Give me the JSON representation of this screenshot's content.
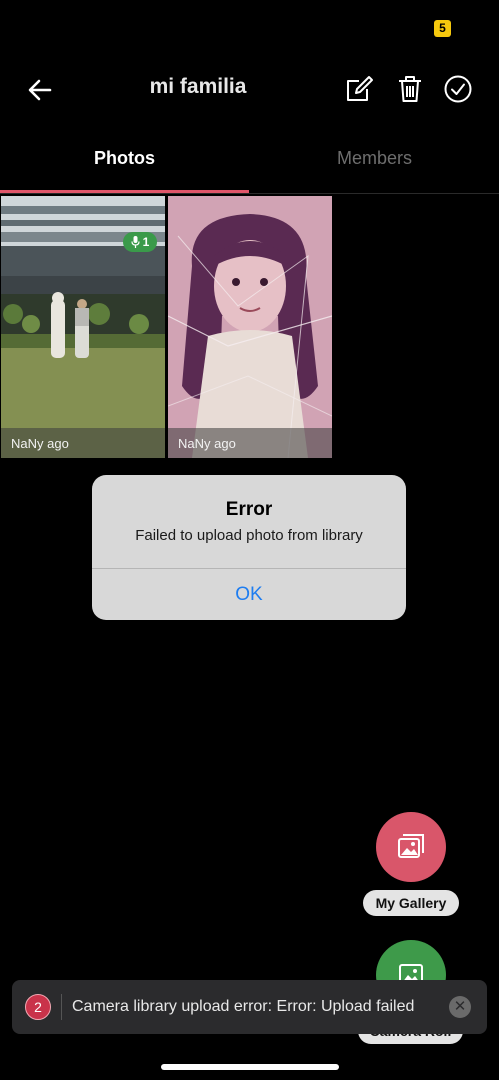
{
  "status_bar": {
    "badge_count": "5"
  },
  "header": {
    "title": "mi familia",
    "icons": [
      "back-arrow-icon",
      "edit-icon",
      "trash-icon",
      "checkmark-circle-icon"
    ]
  },
  "tabs": [
    {
      "label": "Photos",
      "selected": true
    },
    {
      "label": "Members",
      "selected": false
    }
  ],
  "photos": [
    {
      "time": "NaNy ago",
      "audio_count": "1",
      "audio_icon": "microphone-icon"
    },
    {
      "time": "NaNy ago"
    }
  ],
  "alert": {
    "title": "Error",
    "message": "Failed to upload photo from library",
    "ok_label": "OK"
  },
  "fab": {
    "gallery_label": "My Gallery",
    "gallery_icon": "gallery-icon",
    "camera_label": "Camera Roll",
    "camera_icon": "image-icon"
  },
  "toast": {
    "count": "2",
    "message": "Camera library upload error: Error: Upload failed",
    "close_icon": "close-icon"
  },
  "colors": {
    "accent": "#e0566a",
    "gallery_fab": "#d9566a",
    "camera_fab": "#3e9a4a",
    "link": "#1e7df0",
    "status_badge": "#f6c90e"
  }
}
